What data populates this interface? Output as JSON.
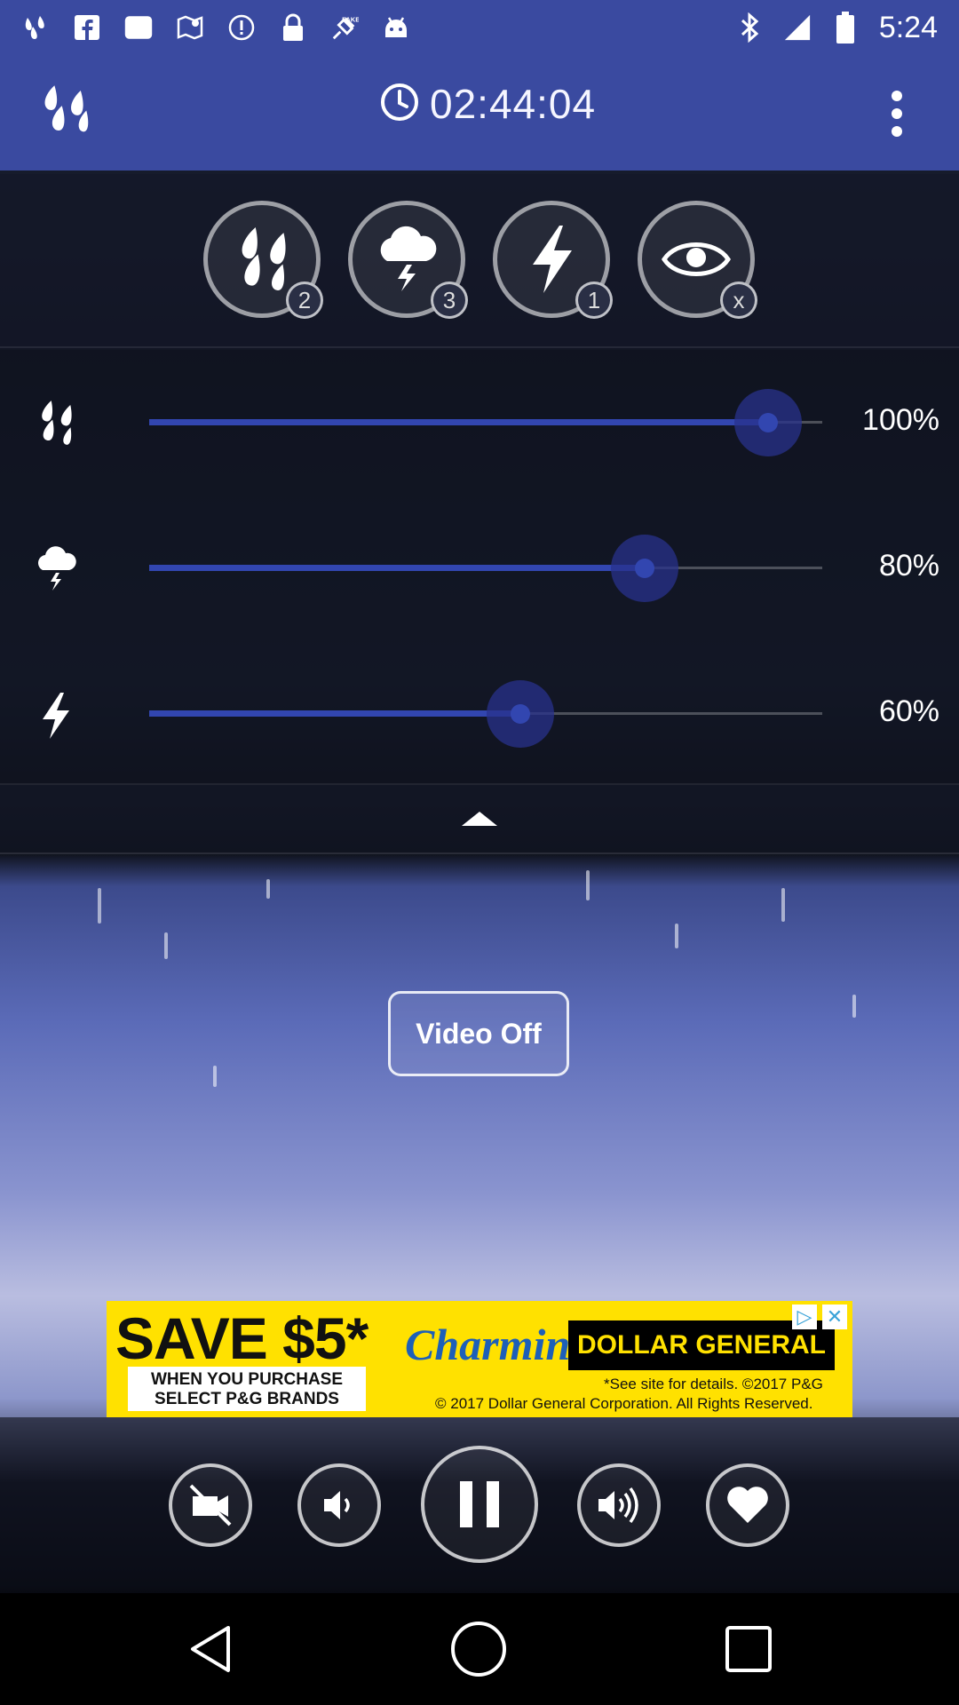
{
  "status_bar": {
    "time": "5:24",
    "left_icons": [
      "rain-app-icon",
      "facebook-icon",
      "blank-card-icon",
      "maps-icon",
      "alert-icon",
      "lock-icon",
      "fake-gps-icon",
      "android-icon"
    ],
    "right_icons": [
      "bluetooth-icon",
      "signal-icon",
      "battery-icon"
    ]
  },
  "toolbar": {
    "timer": "02:44:04"
  },
  "sound_buttons": [
    {
      "name": "rain",
      "badge": "2"
    },
    {
      "name": "thunderstorm",
      "badge": "3"
    },
    {
      "name": "lightning",
      "badge": "1"
    },
    {
      "name": "visual",
      "badge": "x"
    }
  ],
  "sliders": [
    {
      "name": "rain",
      "value": 100,
      "label": "100%"
    },
    {
      "name": "thunderstorm",
      "value": 80,
      "label": "80%"
    },
    {
      "name": "lightning",
      "value": 60,
      "label": "60%"
    }
  ],
  "video": {
    "toggle_label": "Video Off"
  },
  "ad": {
    "headline": "SAVE $5*",
    "sub": "WHEN YOU PURCHASE SELECT P&G BRANDS",
    "brand": "Charmin",
    "store": "DOLLAR GENERAL",
    "fine1": "*See site for details. ©2017 P&G",
    "fine2": "© 2017 Dollar General Corporation. All Rights Reserved."
  },
  "controls": [
    "video-off-icon",
    "volume-down-icon",
    "pause-icon",
    "volume-up-icon",
    "favorite-icon"
  ],
  "colors": {
    "accent": "#3a4aa0",
    "slider_fill": "#3246b0",
    "ad_bg": "#ffe100"
  }
}
